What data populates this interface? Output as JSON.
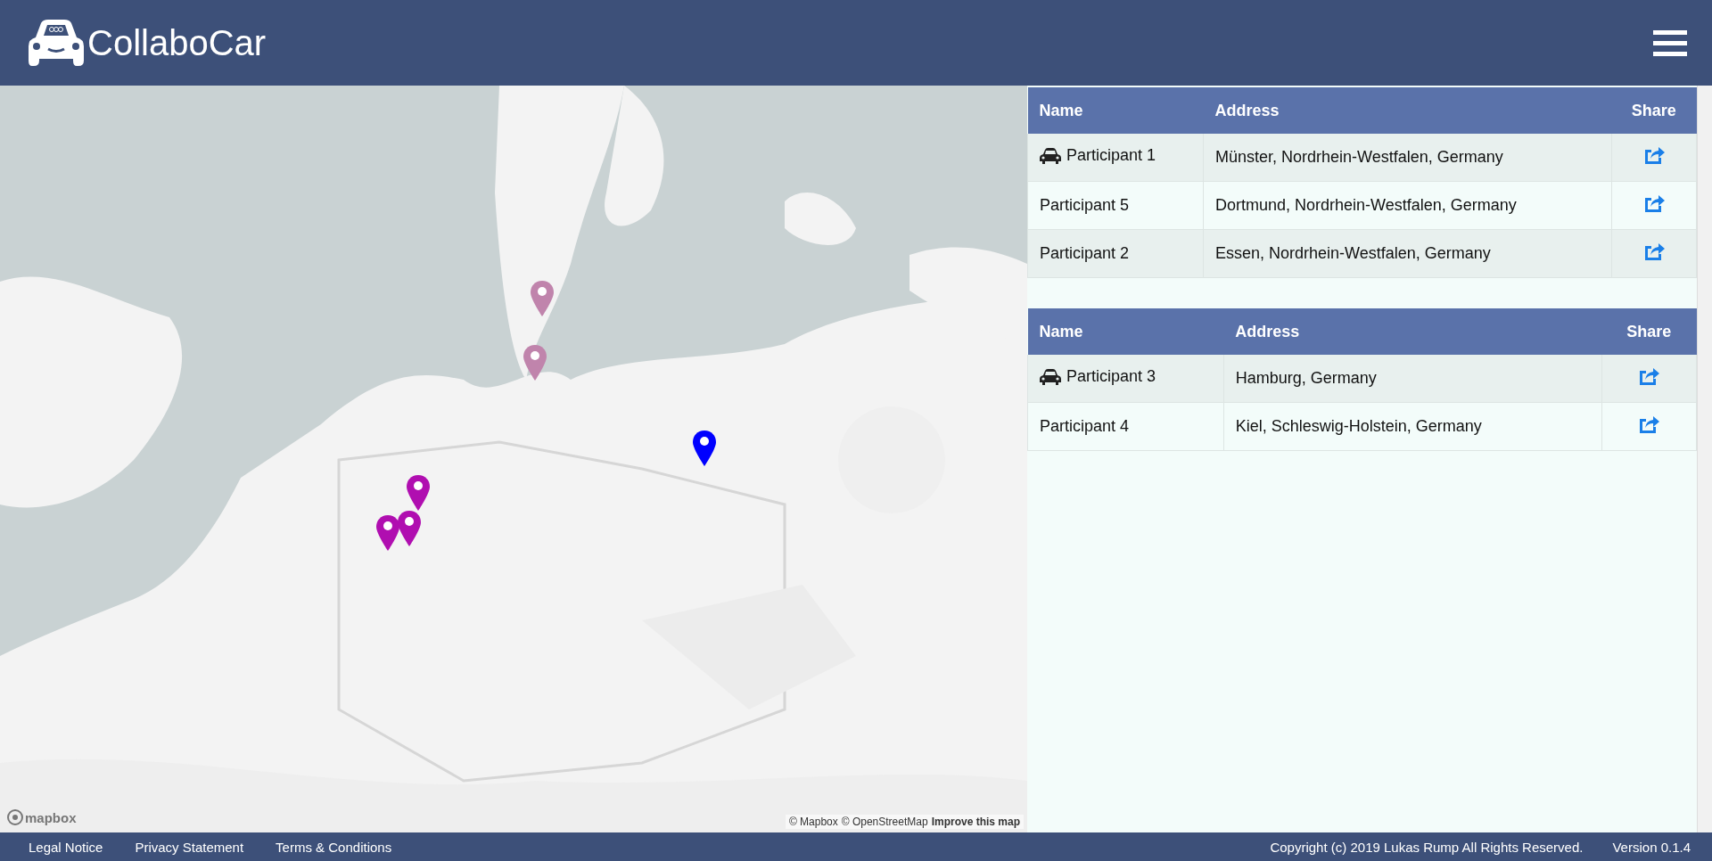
{
  "header": {
    "title": "CollaboCar"
  },
  "map": {
    "pins": [
      {
        "color": "#c084ac"
      },
      {
        "color": "#c084ac"
      },
      {
        "color": "#0000ff"
      },
      {
        "color": "#b00eb0"
      },
      {
        "color": "#b00eb0"
      },
      {
        "color": "#b00eb0"
      }
    ],
    "logo": "mapbox",
    "attribution": [
      "© Mapbox",
      "© OpenStreetMap",
      "Improve this map"
    ]
  },
  "tables": [
    {
      "columns": [
        "Name",
        "Address",
        "Share"
      ],
      "rows": [
        {
          "name": "Participant 1",
          "driver": true,
          "address": "Münster, Nordrhein-Westfalen, Germany"
        },
        {
          "name": "Participant 5",
          "driver": false,
          "address": "Dortmund, Nordrhein-Westfalen, Germany"
        },
        {
          "name": "Participant 2",
          "driver": false,
          "address": "Essen, Nordrhein-Westfalen, Germany"
        }
      ]
    },
    {
      "columns": [
        "Name",
        "Address",
        "Share"
      ],
      "rows": [
        {
          "name": "Participant 3",
          "driver": true,
          "address": "Hamburg, Germany"
        },
        {
          "name": "Participant 4",
          "driver": false,
          "address": "Kiel, Schleswig-Holstein, Germany"
        }
      ]
    }
  ],
  "footer": {
    "links": [
      "Legal Notice",
      "Privacy Statement",
      "Terms & Conditions"
    ],
    "copyright": "Copyright (c) 2019 Lukas Rump All Rights Reserved.",
    "version": "Version 0.1.4"
  }
}
